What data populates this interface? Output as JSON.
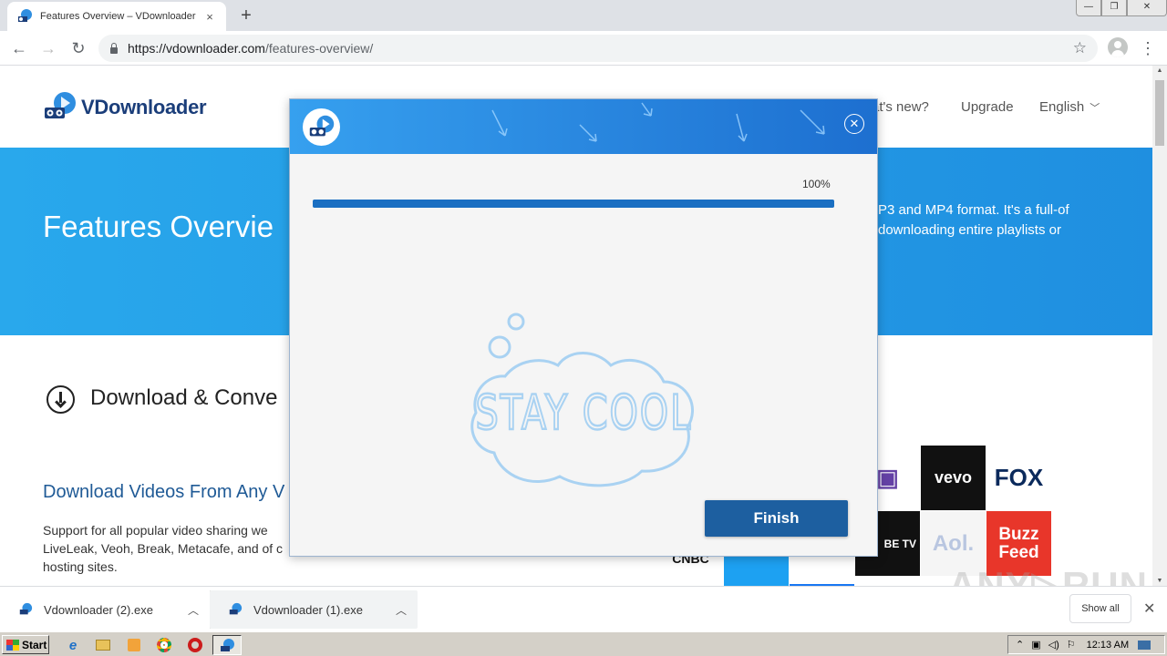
{
  "browser": {
    "tab_title": "Features Overview – VDownloader",
    "tab_close": "×",
    "new_tab": "+",
    "url_host": "https://vdownloader.com",
    "url_path": "/features-overview/",
    "window_controls": {
      "minimize": "—",
      "restore": "❐",
      "close": "✕"
    },
    "nav": {
      "back": "←",
      "forward": "→",
      "reload": "↻"
    },
    "star": "☆",
    "menu": "⋮"
  },
  "site": {
    "logo_text": "VDownloader",
    "nav": [
      {
        "label": "at's new?"
      },
      {
        "label": "Upgrade"
      },
      {
        "label": "English"
      }
    ],
    "hero_title": "Features Overvie",
    "hero_text": "P3 and MP4 format. It's a full-of downloading entire playlists or",
    "section_title": "Download & Conve",
    "sub_title": "Download Videos From Any V",
    "body_text": "Support for all popular video sharing we LiveLeak, Veoh, Break, Metacafe, and of c hosting sites.",
    "brand_logos": [
      {
        "label": "vevo",
        "color": "#111111"
      },
      {
        "label": "FOX",
        "color": "#ffffff"
      },
      {
        "label": "BE TV",
        "color": "#111111"
      },
      {
        "label": "Aol.",
        "color": "#f5f5f5"
      },
      {
        "label": "Buzz Feed",
        "color": "#e8362a"
      },
      {
        "label": "CNBC",
        "color": "#111111"
      }
    ],
    "accent_color": "#1f8fe0"
  },
  "modal": {
    "progress_label": "100%",
    "progress_value": 1.0,
    "illustration_text": "STAY COOL",
    "finish_label": "Finish",
    "close_icon": "✕"
  },
  "downloads": {
    "items": [
      {
        "name": "Vdownloader (2).exe"
      },
      {
        "name": "Vdownloader (1).exe"
      }
    ],
    "show_all": "Show all",
    "close": "✕",
    "caret": "︿"
  },
  "watermark": "ANY▷RUN",
  "taskbar": {
    "start_label": "Start",
    "clock": "12:13 AM"
  }
}
